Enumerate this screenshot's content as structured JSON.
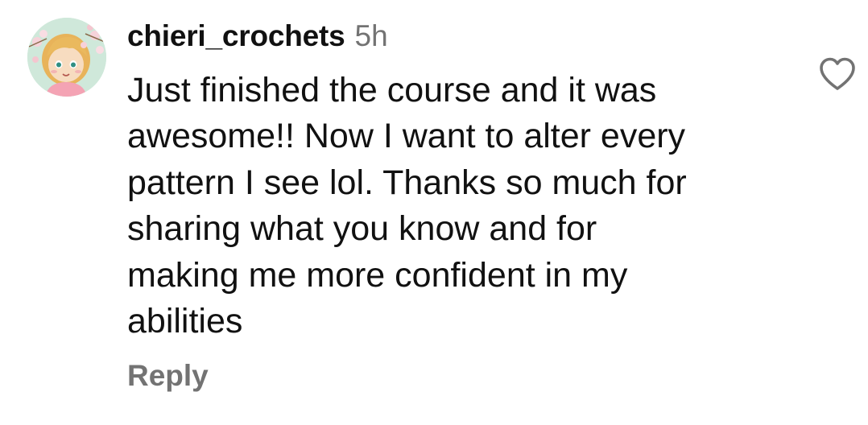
{
  "comment": {
    "username": "chieri_crochets",
    "timestamp": "5h",
    "text_lines": [
      "Just finished the course and it was",
      "awesome!! Now I want to alter every",
      "pattern I see lol. Thanks so much for",
      "sharing what you know and for",
      "making me more confident in my",
      "abilities"
    ],
    "reply_label": "Reply",
    "like_icon": "heart-outline-icon"
  },
  "colors": {
    "text": "#111111",
    "secondary": "#737373",
    "background": "#ffffff"
  }
}
